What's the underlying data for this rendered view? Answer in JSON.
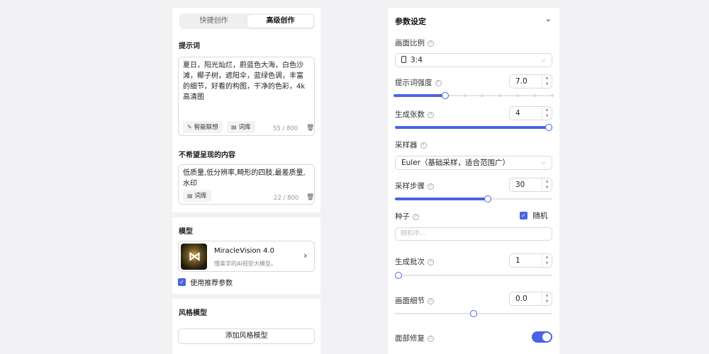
{
  "tabs": [
    {
      "label": "快捷创作",
      "active": false
    },
    {
      "label": "高级创作",
      "active": true
    }
  ],
  "prompt": {
    "label": "提示词",
    "text": "夏日，阳光灿烂，蔚蓝色大海，白色沙滩，椰子树，遮阳伞，蓝绿色调，丰富的细节，好看的构图，干净的色彩，4k高清图",
    "smart_label": "智能联想",
    "library_label": "词库",
    "counter": "55 / 800"
  },
  "negative": {
    "label": "不希望呈现的内容",
    "text": "低质量,低分辨率,畸形的四肢,最差质量,水印",
    "library_label": "词库",
    "counter": "22 / 800"
  },
  "model": {
    "label": "模型",
    "name": "MiracleVision 4.0",
    "desc": "懂美学的AI视觉大模型。",
    "recommend_label": "使用推荐参数",
    "recommend_checked": true
  },
  "style_model": {
    "label": "风格模型",
    "add_label": "添加风格模型"
  },
  "params": {
    "title": "参数设定",
    "ratio_label": "画面比例",
    "ratio_value": "3:4",
    "prompt_strength_label": "提示词强度",
    "prompt_strength_value": "7.0",
    "prompt_strength_fraction": 0.32,
    "count_label": "生成张数",
    "count_value": "4",
    "count_fraction": 1.0,
    "sampler_label": "采样器",
    "sampler_value": "Euler（基础采样，适合范围广）",
    "steps_label": "采样步骤",
    "steps_value": "30",
    "steps_fraction": 0.59,
    "seed_label": "种子",
    "seed_random_label": "随机",
    "seed_random_checked": true,
    "seed_placeholder": "随机中...",
    "batch_label": "生成批次",
    "batch_value": "1",
    "batch_fraction": 0.0,
    "detail_label": "画面细节",
    "detail_value": "0.0",
    "detail_fraction": 0.5,
    "face_fix_label": "面部修复",
    "face_fix_on": true
  },
  "colors": {
    "accent": "#4a63e6",
    "border": "#d9d9de",
    "background": "#f2f2f4"
  }
}
